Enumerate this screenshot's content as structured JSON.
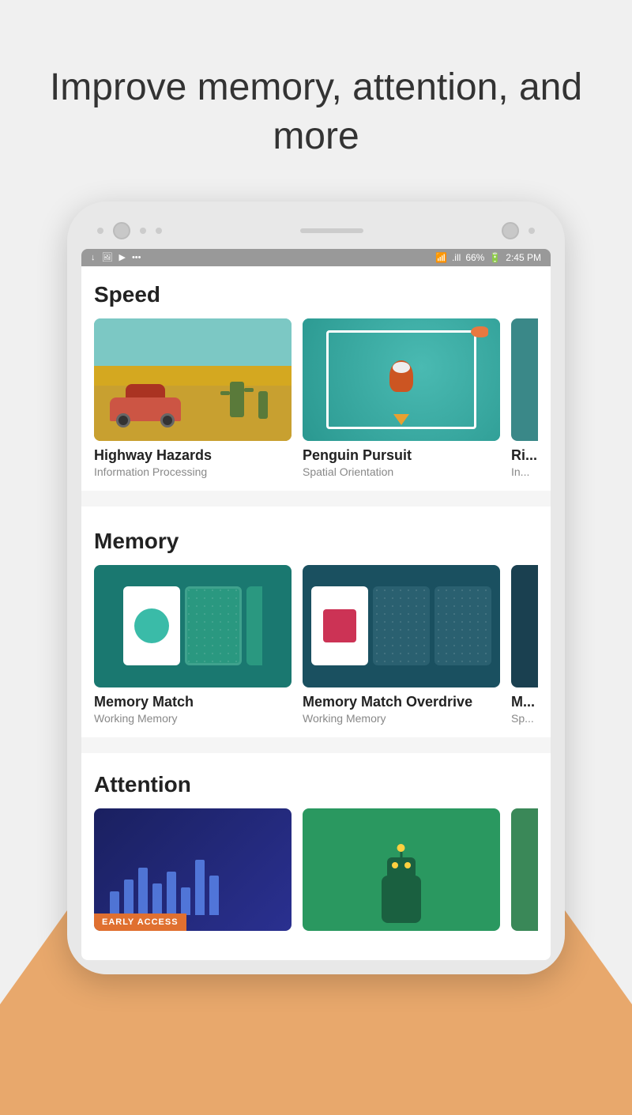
{
  "header": {
    "title": "Improve memory,\nattention, and more"
  },
  "status_bar": {
    "time": "2:45 PM",
    "battery": "66%",
    "icons_left": [
      "↓",
      "🖼",
      "▶",
      "•••"
    ]
  },
  "sections": {
    "speed": {
      "label": "Speed",
      "games": [
        {
          "name": "Highway Hazards",
          "category": "Information Processing"
        },
        {
          "name": "Penguin Pursuit",
          "category": "Spatial Orientation"
        },
        {
          "name": "Ri...",
          "category": "In..."
        }
      ]
    },
    "memory": {
      "label": "Memory",
      "games": [
        {
          "name": "Memory Match",
          "category": "Working Memory"
        },
        {
          "name": "Memory Match Overdrive",
          "category": "Working Memory"
        },
        {
          "name": "M...",
          "category": "Sp..."
        }
      ]
    },
    "attention": {
      "label": "Attention",
      "games": [
        {
          "name": "",
          "category": "",
          "badge": "EARLY ACCESS"
        },
        {
          "name": "",
          "category": ""
        }
      ]
    }
  }
}
